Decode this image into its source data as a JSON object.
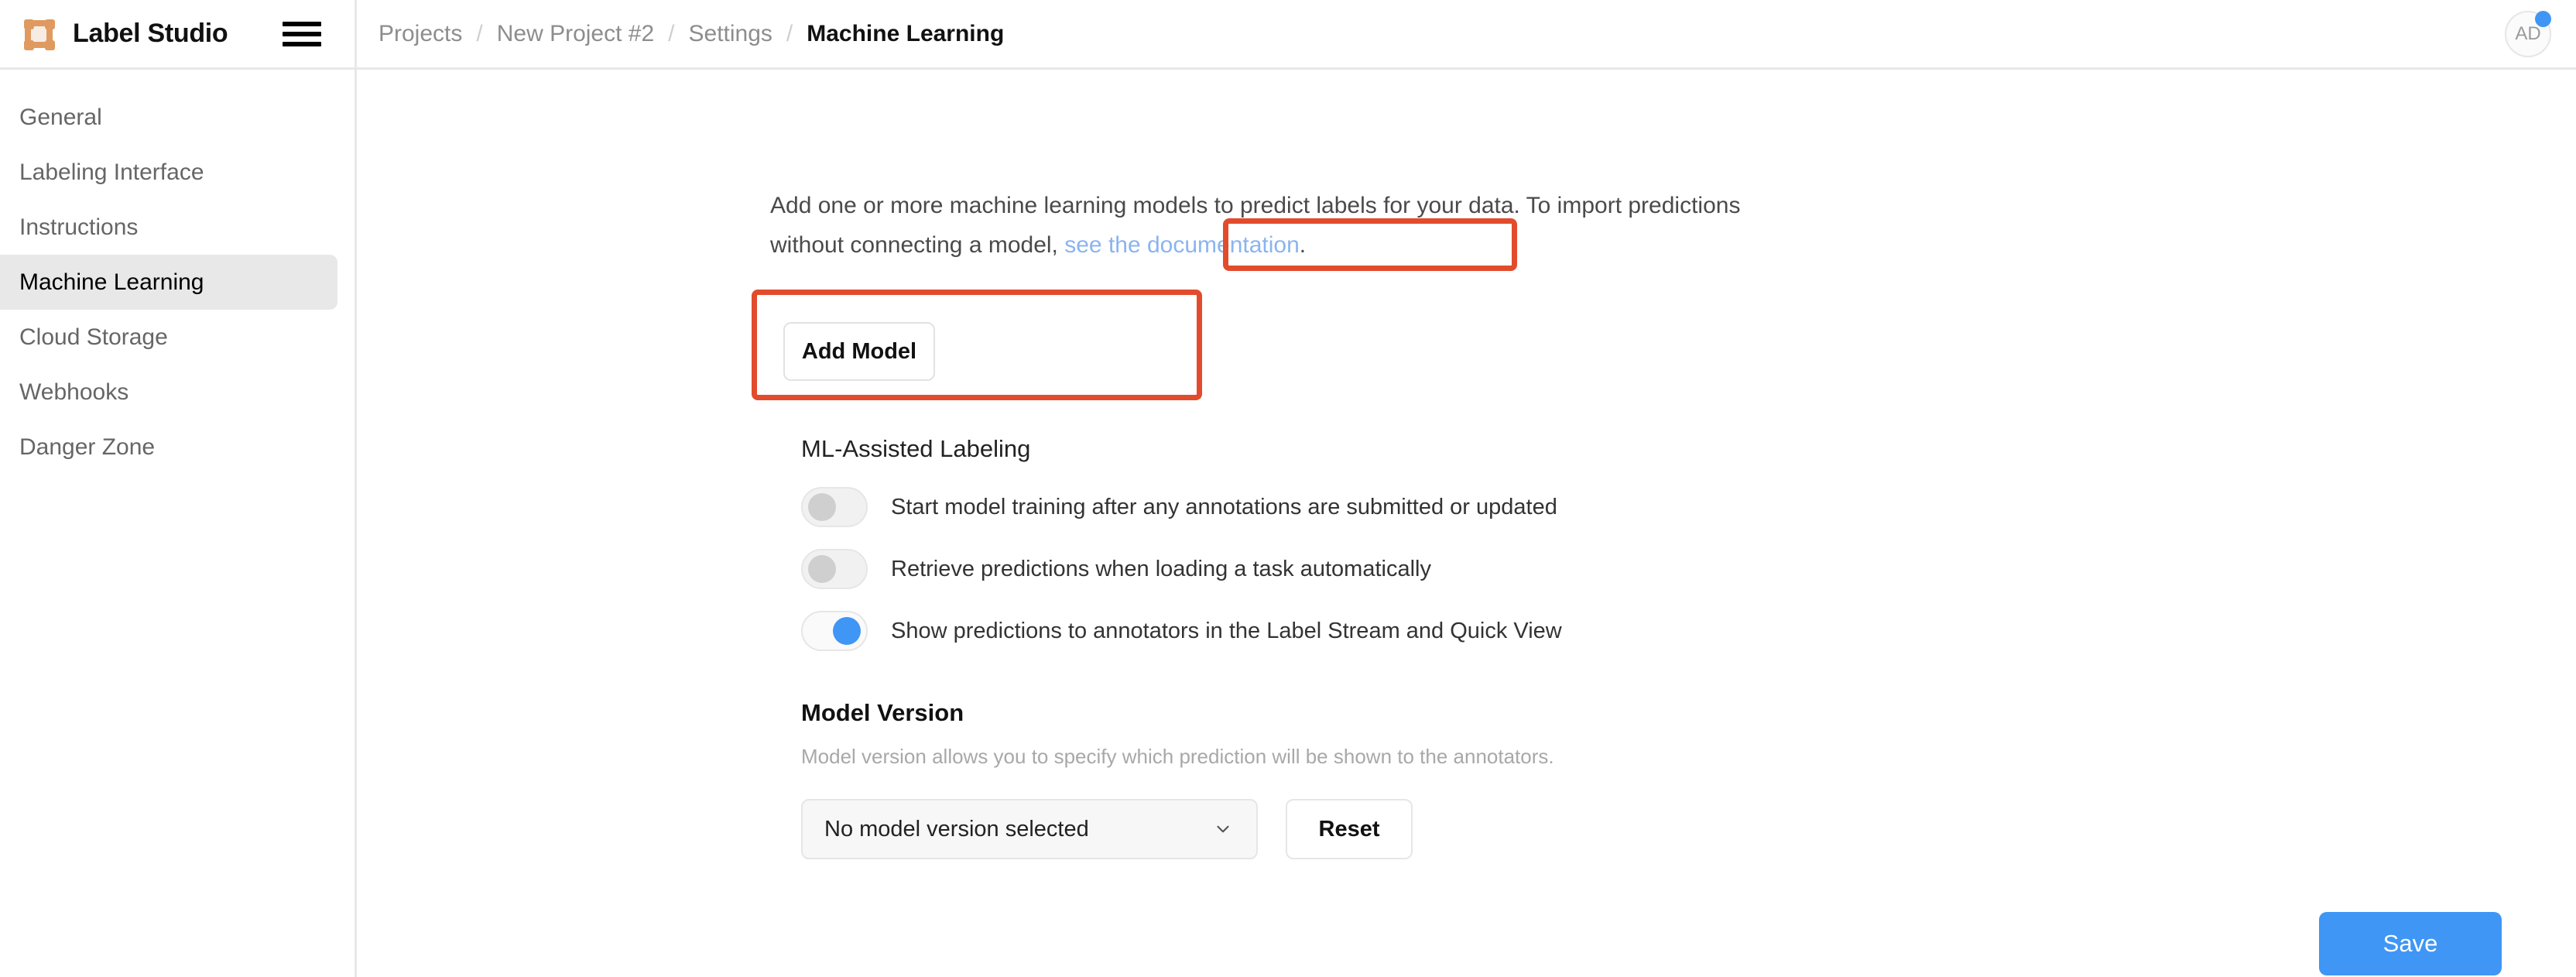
{
  "brand": {
    "name": "Label Studio",
    "logo_icon": "label-studio-bbox-icon",
    "menu_icon": "hamburger-menu-icon"
  },
  "sidebar": {
    "items": [
      {
        "label": "General",
        "active": false
      },
      {
        "label": "Labeling Interface",
        "active": false
      },
      {
        "label": "Instructions",
        "active": false
      },
      {
        "label": "Machine Learning",
        "active": true
      },
      {
        "label": "Cloud Storage",
        "active": false
      },
      {
        "label": "Webhooks",
        "active": false
      },
      {
        "label": "Danger Zone",
        "active": false
      }
    ]
  },
  "topbar": {
    "breadcrumb": [
      {
        "label": "Projects",
        "current": false
      },
      {
        "label": "New Project #2",
        "current": false
      },
      {
        "label": "Settings",
        "current": false
      },
      {
        "label": "Machine Learning",
        "current": true
      }
    ],
    "separator": "/",
    "avatar": {
      "initials": "AD",
      "badge_color": "#3f96f5"
    }
  },
  "main": {
    "intro": {
      "text_before_link": "Add one or more machine learning models to predict labels for your data. To import predictions without connecting a model,",
      "link_text": "see the documentation",
      "text_after_link": "."
    },
    "add_model_button": "Add Model",
    "ml_assisted_labeling": {
      "title": "ML-Assisted Labeling",
      "toggles": [
        {
          "label": "Start model training after any annotations are submitted or updated",
          "on": false
        },
        {
          "label": "Retrieve predictions when loading a task automatically",
          "on": false
        },
        {
          "label": "Show predictions to annotators in the Label Stream and Quick View",
          "on": true
        }
      ]
    },
    "model_version": {
      "title": "Model Version",
      "description": "Model version allows you to specify which prediction will be shown to the annotators.",
      "select_value": "No model version selected",
      "select_icon": "chevron-down-icon",
      "reset_button": "Reset"
    },
    "save_button": "Save"
  },
  "annotations": {
    "color": "#e24b2c",
    "boxes": [
      {
        "name": "documentation-link-highlight"
      },
      {
        "name": "add-model-button-highlight"
      }
    ]
  },
  "colors": {
    "accent_blue": "#3f96f5",
    "link_blue": "#8ab4f0",
    "brand_orange": "#e09a5f",
    "annotation_red": "#e24b2c"
  }
}
